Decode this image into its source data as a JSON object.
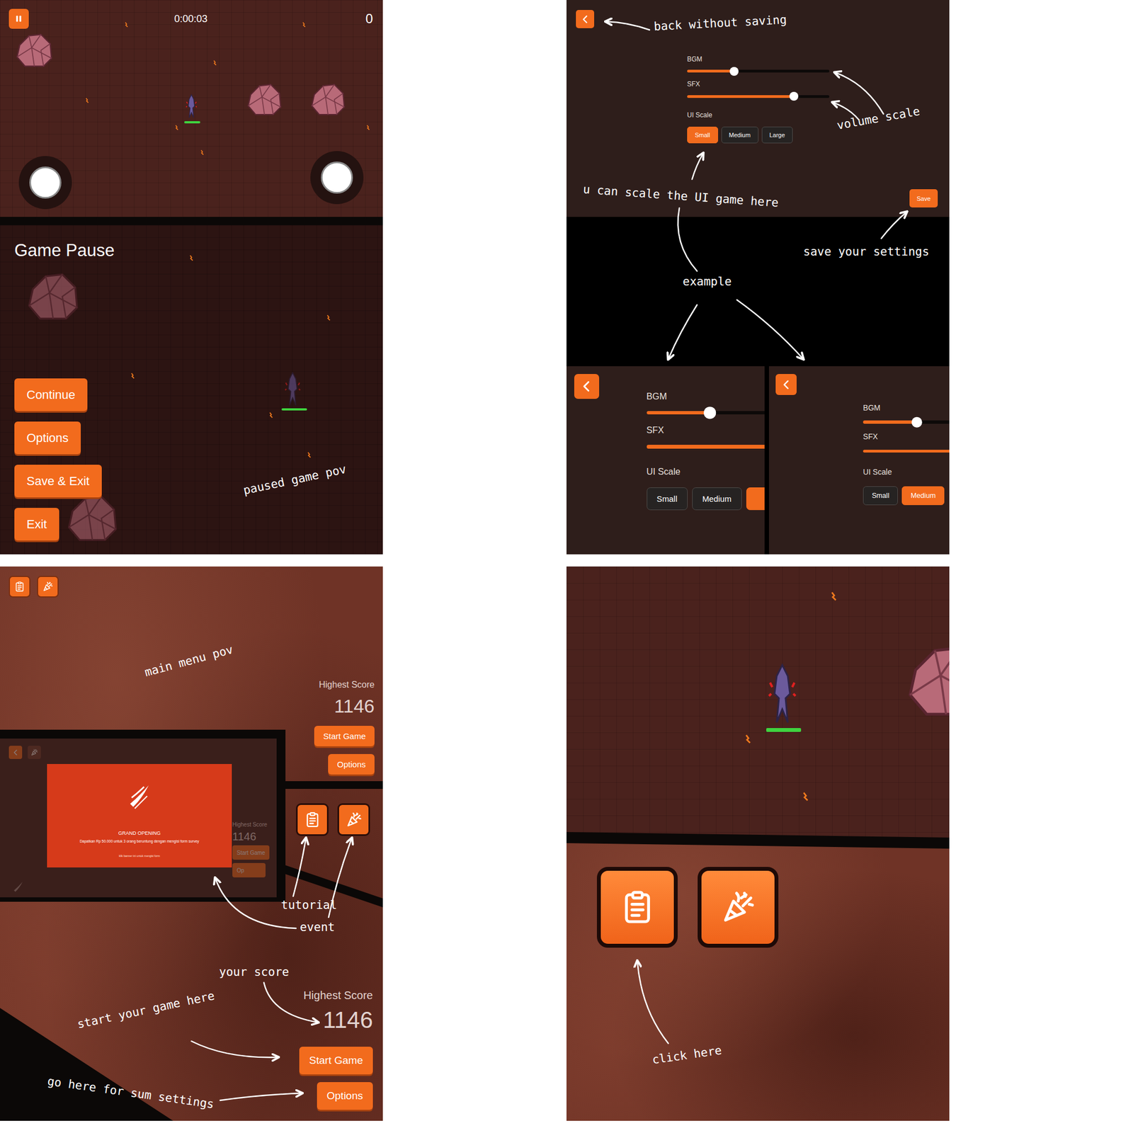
{
  "paused_game": {
    "hud": {
      "timer": "0:00:03",
      "score": "0"
    },
    "pause_menu": {
      "title": "Game Pause",
      "buttons": [
        {
          "label": "Continue"
        },
        {
          "label": "Options"
        },
        {
          "label": "Save & Exit"
        },
        {
          "label": "Exit"
        }
      ]
    },
    "note": "paused game pov"
  },
  "settings": {
    "sliders": [
      {
        "label": "BGM",
        "level": 0.33
      },
      {
        "label": "SFX",
        "level": 0.75
      }
    ],
    "scale_label": "UI Scale",
    "scale_options": [
      {
        "label": "Small",
        "selected": true
      },
      {
        "label": "Medium",
        "selected": false
      },
      {
        "label": "Large",
        "selected": false
      }
    ],
    "save": "Save",
    "notes": {
      "back": "back without saving",
      "volume": "volume scale",
      "scale": "u can scale the UI game here",
      "save": "save your settings",
      "example": "example"
    },
    "examples": [
      {
        "sliders": [
          {
            "label": "BGM",
            "level": 0.33
          },
          {
            "label": "SFX",
            "level": 0.75
          }
        ],
        "scale_label": "UI Scale",
        "scale_options": [
          {
            "label": "Small",
            "selected": false
          },
          {
            "label": "Medium",
            "selected": false
          },
          {
            "label": "",
            "selected": true
          }
        ]
      },
      {
        "sliders": [
          {
            "label": "BGM",
            "level": 0.33
          },
          {
            "label": "SFX",
            "level": 0.75
          }
        ],
        "scale_label": "UI Scale",
        "scale_options": [
          {
            "label": "Small",
            "selected": false
          },
          {
            "label": "Medium",
            "selected": true
          }
        ]
      }
    ]
  },
  "main_menu": {
    "note": "main menu pov",
    "score_label": "Highest Score",
    "score": "1146",
    "buttons": [
      {
        "label": "Start Game"
      },
      {
        "label": "Options"
      }
    ],
    "event_popup": {
      "title": "GRAND OPENING",
      "text": "Dapatkan Rp 50.000 untuk 3 orang beruntung dengan mengisi form survey",
      "hint": "klik banner ini untuk mengisi form",
      "behind": {
        "score_label": "Highest Score",
        "score": "1146",
        "buttons": [
          {
            "label": "Start Game"
          },
          {
            "label": "Op"
          }
        ]
      }
    },
    "notes": {
      "tutorial": "tutorial",
      "event": "event",
      "score": "your score",
      "start": "start your game here",
      "options": "go here for sum settings"
    },
    "zoom": {
      "score_label": "Highest Score",
      "score": "1146",
      "buttons": [
        {
          "label": "Start Game"
        },
        {
          "label": "Options"
        }
      ]
    }
  },
  "icon_zoom": {
    "note": "click here"
  }
}
